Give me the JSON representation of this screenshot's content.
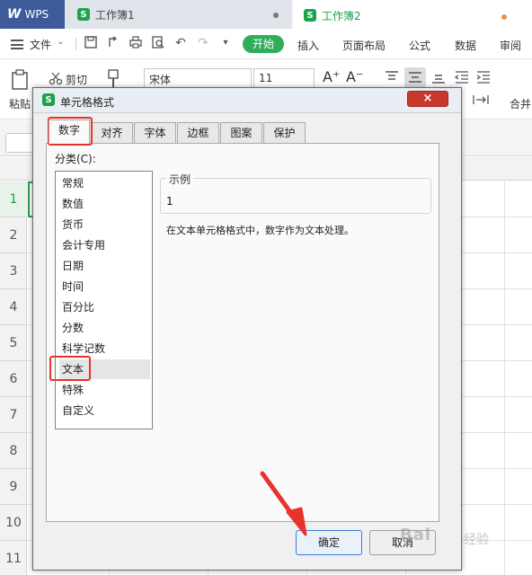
{
  "titlebar": {
    "app": "WPS",
    "tabs": [
      {
        "label": "工作簿1"
      },
      {
        "label": "工作簿2"
      }
    ]
  },
  "menubar": {
    "file": "文件",
    "start": "开始",
    "items": [
      "插入",
      "页面布局",
      "公式",
      "数据",
      "审阅"
    ]
  },
  "toolbar": {
    "paste": "粘贴",
    "cut": "剪切",
    "font_name": "宋体",
    "font_size": "11",
    "merge": "合并"
  },
  "sheet": {
    "rows": [
      "1",
      "2",
      "3",
      "4",
      "5",
      "6",
      "7",
      "8",
      "9",
      "10",
      "11"
    ]
  },
  "dialog": {
    "title": "单元格格式",
    "close": "×",
    "tabs": [
      "数字",
      "对齐",
      "字体",
      "边框",
      "图案",
      "保护"
    ],
    "category_label": "分类(C):",
    "categories": [
      "常规",
      "数值",
      "货币",
      "会计专用",
      "日期",
      "时间",
      "百分比",
      "分数",
      "科学记数",
      "文本",
      "特殊",
      "自定义"
    ],
    "selected_category": "文本",
    "sample_label": "示例",
    "sample_value": "1",
    "description": "在文本单元格格式中，数字作为文本处理。",
    "ok": "确定",
    "cancel": "取消"
  },
  "watermark": {
    "brand": "Bai",
    "sub": "经验"
  },
  "colors": {
    "wps_blue": "#3d5a9b",
    "accent_green": "#2fae5a",
    "annotation_red": "#e8332c",
    "ok_border": "#3a7dd6"
  }
}
